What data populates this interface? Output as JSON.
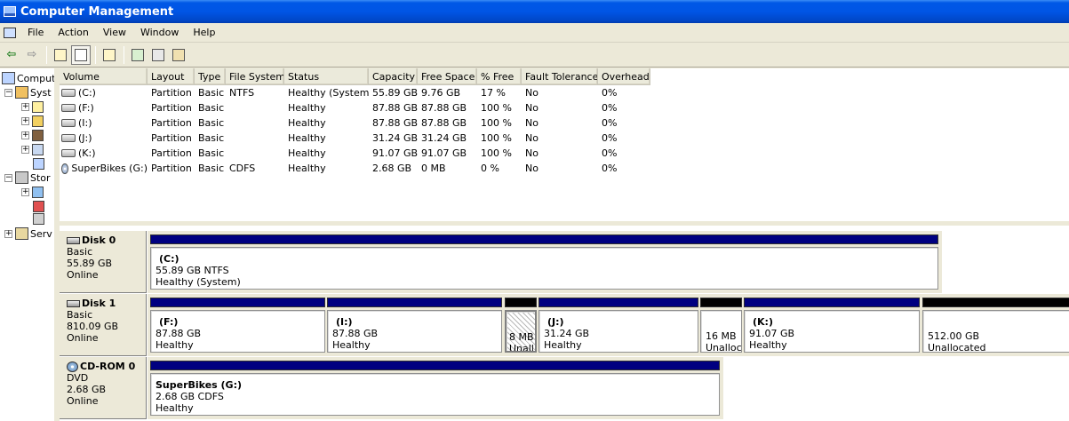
{
  "window": {
    "title": "Computer Management"
  },
  "menu": [
    "File",
    "Action",
    "View",
    "Window",
    "Help"
  ],
  "tree": {
    "root": "Compute",
    "system_tools": "Syst",
    "storage": "Stor",
    "services": "Serv"
  },
  "volume_list": {
    "columns": [
      "Volume",
      "Layout",
      "Type",
      "File System",
      "Status",
      "Capacity",
      "Free Space",
      "% Free",
      "Fault Tolerance",
      "Overhead"
    ],
    "rows": [
      {
        "volume": "(C:)",
        "layout": "Partition",
        "type": "Basic",
        "fs": "NTFS",
        "status": "Healthy (System)",
        "capacity": "55.89 GB",
        "free": "9.76 GB",
        "pct": "17 %",
        "fault": "No",
        "overhead": "0%",
        "icon": "disk"
      },
      {
        "volume": "(F:)",
        "layout": "Partition",
        "type": "Basic",
        "fs": "",
        "status": "Healthy",
        "capacity": "87.88 GB",
        "free": "87.88 GB",
        "pct": "100 %",
        "fault": "No",
        "overhead": "0%",
        "icon": "disk"
      },
      {
        "volume": "(I:)",
        "layout": "Partition",
        "type": "Basic",
        "fs": "",
        "status": "Healthy",
        "capacity": "87.88 GB",
        "free": "87.88 GB",
        "pct": "100 %",
        "fault": "No",
        "overhead": "0%",
        "icon": "disk"
      },
      {
        "volume": "(J:)",
        "layout": "Partition",
        "type": "Basic",
        "fs": "",
        "status": "Healthy",
        "capacity": "31.24 GB",
        "free": "31.24 GB",
        "pct": "100 %",
        "fault": "No",
        "overhead": "0%",
        "icon": "disk"
      },
      {
        "volume": "(K:)",
        "layout": "Partition",
        "type": "Basic",
        "fs": "",
        "status": "Healthy",
        "capacity": "91.07 GB",
        "free": "91.07 GB",
        "pct": "100 %",
        "fault": "No",
        "overhead": "0%",
        "icon": "disk"
      },
      {
        "volume": "SuperBikes (G:)",
        "layout": "Partition",
        "type": "Basic",
        "fs": "CDFS",
        "status": "Healthy",
        "capacity": "2.68 GB",
        "free": "0 MB",
        "pct": "0 %",
        "fault": "No",
        "overhead": "0%",
        "icon": "cdrom"
      }
    ]
  },
  "disks": [
    {
      "name": "Disk 0",
      "type": "Basic",
      "size": "55.89 GB",
      "state": "Online",
      "icon": "disk",
      "partitions": [
        {
          "label": "(C:)",
          "line1": "55.89 GB NTFS",
          "line2": "Healthy (System)",
          "bar": "blue",
          "hatched": false
        }
      ]
    },
    {
      "name": "Disk 1",
      "type": "Basic",
      "size": "810.09 GB",
      "state": "Online",
      "icon": "disk",
      "partitions": [
        {
          "label": "(F:)",
          "line1": "87.88 GB",
          "line2": "Healthy",
          "bar": "blue",
          "hatched": false
        },
        {
          "label": "(I:)",
          "line1": "87.88 GB",
          "line2": "Healthy",
          "bar": "blue",
          "hatched": false
        },
        {
          "label": "",
          "line1": "8 MB",
          "line2": "Unall",
          "bar": "black",
          "hatched": true
        },
        {
          "label": "(J:)",
          "line1": "31.24 GB",
          "line2": "Healthy",
          "bar": "blue",
          "hatched": false
        },
        {
          "label": "",
          "line1": "16 MB",
          "line2": "Unalloc",
          "bar": "black",
          "hatched": false
        },
        {
          "label": "(K:)",
          "line1": "91.07 GB",
          "line2": "Healthy",
          "bar": "blue",
          "hatched": false
        },
        {
          "label": "",
          "line1": "512.00 GB",
          "line2": "Unallocated",
          "bar": "black",
          "hatched": false
        }
      ]
    },
    {
      "name": "CD-ROM 0",
      "type": "DVD",
      "size": "2.68 GB",
      "state": "Online",
      "icon": "cdrom",
      "partitions": [
        {
          "label": "SuperBikes  (G:)",
          "line1": "2.68 GB CDFS",
          "line2": "Healthy",
          "bar": "blue",
          "hatched": false
        }
      ]
    }
  ]
}
